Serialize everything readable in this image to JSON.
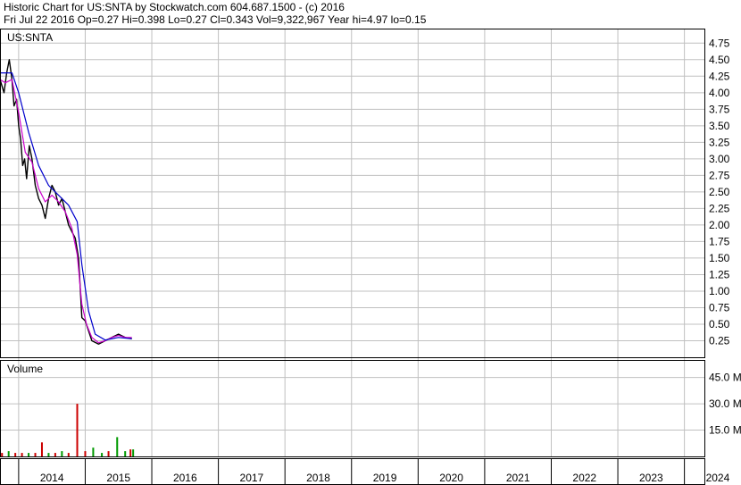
{
  "header": {
    "line1": "Historic Chart for US:SNTA by Stockwatch.com 604.687.1500 - (c) 2016",
    "line2": "Fri Jul 22 2016  Op=0.27  Hi=0.398  Lo=0.27  Cl=0.343  Vol=9,322,967  Year hi=4.97  lo=0.15"
  },
  "chart_data": {
    "type": "line",
    "symbol_label": "US:SNTA",
    "volume_label": "Volume",
    "x_ticks": [
      "2014",
      "2015",
      "2016",
      "2017",
      "2018",
      "2019",
      "2020",
      "2021",
      "2022",
      "2023",
      "2024"
    ],
    "x_range": [
      2013.72,
      2024.3
    ],
    "price_ylim": [
      0,
      4.97
    ],
    "price_ticks": [
      "0.25",
      "0.50",
      "0.75",
      "1.00",
      "1.25",
      "1.50",
      "1.75",
      "2.00",
      "2.25",
      "2.50",
      "2.75",
      "3.00",
      "3.25",
      "3.50",
      "3.75",
      "4.00",
      "4.25",
      "4.50",
      "4.75"
    ],
    "volume_ylim": [
      0,
      55
    ],
    "volume_ticks": [
      "15.0 M",
      "30.0 M",
      "45.0 M"
    ],
    "volume_tick_values": [
      15,
      30,
      45
    ],
    "colors": {
      "price": "#000000",
      "ma_short": "#cc00cc",
      "ma_long": "#0000cc",
      "vol_up": "#009900",
      "vol_down": "#cc0000",
      "grid": "#c0c0c0"
    },
    "series": [
      {
        "key": "price",
        "points": [
          [
            2013.72,
            4.2
          ],
          [
            2013.78,
            4.0
          ],
          [
            2013.82,
            4.3
          ],
          [
            2013.86,
            4.5
          ],
          [
            2013.9,
            4.2
          ],
          [
            2013.93,
            3.8
          ],
          [
            2013.97,
            3.9
          ],
          [
            2014.0,
            3.5
          ],
          [
            2014.03,
            3.3
          ],
          [
            2014.06,
            2.9
          ],
          [
            2014.09,
            3.0
          ],
          [
            2014.12,
            2.7
          ],
          [
            2014.16,
            3.2
          ],
          [
            2014.2,
            3.0
          ],
          [
            2014.25,
            2.6
          ],
          [
            2014.3,
            2.4
          ],
          [
            2014.35,
            2.3
          ],
          [
            2014.4,
            2.1
          ],
          [
            2014.45,
            2.4
          ],
          [
            2014.5,
            2.6
          ],
          [
            2014.55,
            2.5
          ],
          [
            2014.6,
            2.3
          ],
          [
            2014.65,
            2.4
          ],
          [
            2014.7,
            2.2
          ],
          [
            2014.75,
            2.0
          ],
          [
            2014.8,
            1.9
          ],
          [
            2014.85,
            1.8
          ],
          [
            2014.9,
            1.5
          ],
          [
            2014.95,
            0.6
          ],
          [
            2015.0,
            0.55
          ],
          [
            2015.05,
            0.4
          ],
          [
            2015.1,
            0.25
          ],
          [
            2015.2,
            0.2
          ],
          [
            2015.3,
            0.25
          ],
          [
            2015.4,
            0.3
          ],
          [
            2015.5,
            0.35
          ],
          [
            2015.6,
            0.3
          ],
          [
            2015.7,
            0.28
          ]
        ]
      },
      {
        "key": "ma_short",
        "points": [
          [
            2013.72,
            4.2
          ],
          [
            2013.8,
            4.15
          ],
          [
            2013.9,
            4.2
          ],
          [
            2014.0,
            3.7
          ],
          [
            2014.1,
            3.1
          ],
          [
            2014.2,
            2.95
          ],
          [
            2014.3,
            2.55
          ],
          [
            2014.4,
            2.35
          ],
          [
            2014.5,
            2.45
          ],
          [
            2014.6,
            2.35
          ],
          [
            2014.7,
            2.2
          ],
          [
            2014.8,
            1.95
          ],
          [
            2014.88,
            1.55
          ],
          [
            2014.95,
            0.8
          ],
          [
            2015.02,
            0.5
          ],
          [
            2015.1,
            0.3
          ],
          [
            2015.2,
            0.22
          ],
          [
            2015.3,
            0.25
          ],
          [
            2015.4,
            0.3
          ],
          [
            2015.5,
            0.33
          ],
          [
            2015.6,
            0.3
          ],
          [
            2015.7,
            0.3
          ]
        ]
      },
      {
        "key": "ma_long",
        "points": [
          [
            2013.72,
            4.3
          ],
          [
            2013.9,
            4.3
          ],
          [
            2014.0,
            4.0
          ],
          [
            2014.15,
            3.4
          ],
          [
            2014.3,
            2.9
          ],
          [
            2014.45,
            2.6
          ],
          [
            2014.6,
            2.45
          ],
          [
            2014.75,
            2.3
          ],
          [
            2014.88,
            2.05
          ],
          [
            2014.95,
            1.4
          ],
          [
            2015.05,
            0.7
          ],
          [
            2015.15,
            0.35
          ],
          [
            2015.3,
            0.26
          ],
          [
            2015.5,
            0.3
          ],
          [
            2015.7,
            0.28
          ]
        ]
      }
    ],
    "volume": [
      {
        "x": 2013.75,
        "v": 2,
        "up": false
      },
      {
        "x": 2013.85,
        "v": 3,
        "up": true
      },
      {
        "x": 2013.95,
        "v": 2,
        "up": false
      },
      {
        "x": 2014.05,
        "v": 2,
        "up": false
      },
      {
        "x": 2014.15,
        "v": 2,
        "up": true
      },
      {
        "x": 2014.25,
        "v": 2,
        "up": false
      },
      {
        "x": 2014.35,
        "v": 8,
        "up": false
      },
      {
        "x": 2014.45,
        "v": 2,
        "up": true
      },
      {
        "x": 2014.55,
        "v": 2,
        "up": false
      },
      {
        "x": 2014.65,
        "v": 3,
        "up": true
      },
      {
        "x": 2014.75,
        "v": 2,
        "up": false
      },
      {
        "x": 2014.88,
        "v": 30,
        "up": false
      },
      {
        "x": 2015.0,
        "v": 3,
        "up": false
      },
      {
        "x": 2015.12,
        "v": 5,
        "up": true
      },
      {
        "x": 2015.25,
        "v": 2,
        "up": true
      },
      {
        "x": 2015.35,
        "v": 3,
        "up": false
      },
      {
        "x": 2015.48,
        "v": 11,
        "up": true
      },
      {
        "x": 2015.6,
        "v": 3,
        "up": true
      },
      {
        "x": 2015.68,
        "v": 4,
        "up": false
      },
      {
        "x": 2015.72,
        "v": 4,
        "up": true
      }
    ]
  }
}
